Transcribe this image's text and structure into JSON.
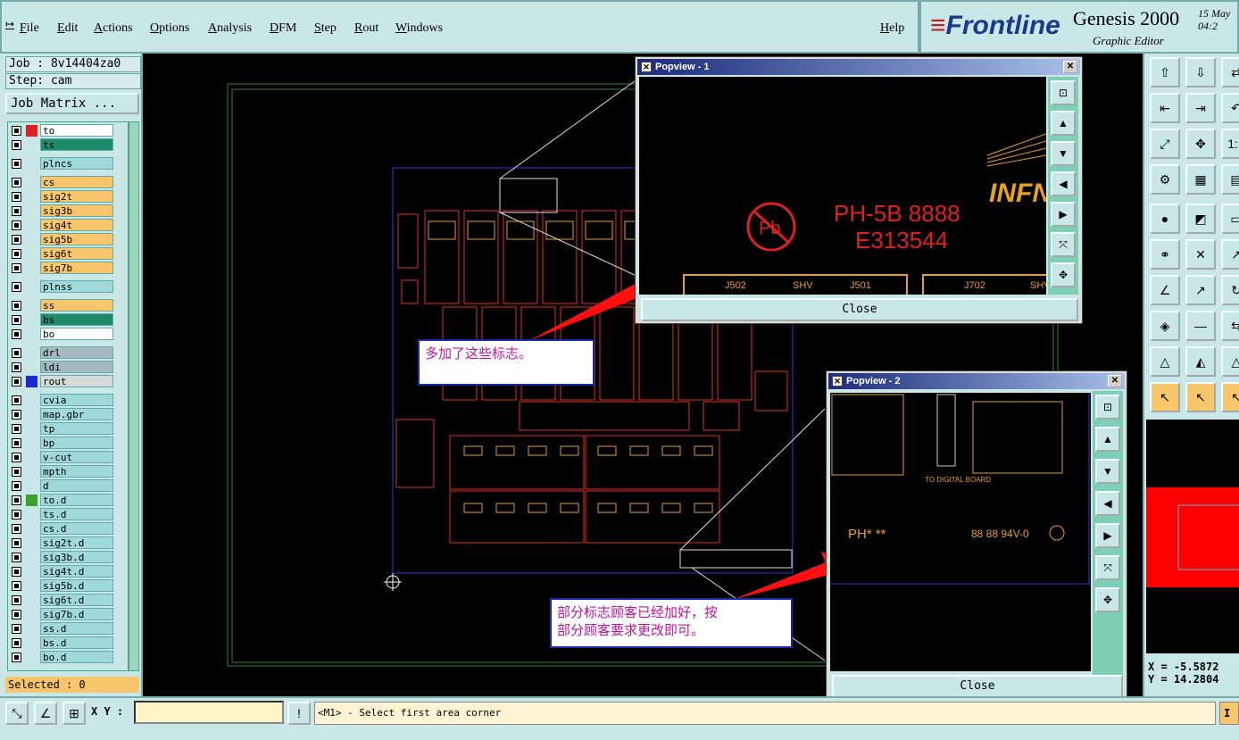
{
  "menu": {
    "items": [
      "File",
      "Edit",
      "Actions",
      "Options",
      "Analysis",
      "DFM",
      "Step",
      "Rout",
      "Windows"
    ],
    "help": "Help"
  },
  "brand": {
    "logo": "Frontline",
    "product": "Genesis 2000",
    "subtitle": "Graphic Editor",
    "date_line1": "15 May",
    "date_line2": "04:2"
  },
  "left": {
    "job": "Job : 8v14404za0",
    "step": "Step: cam",
    "job_matrix": "Job Matrix ...",
    "selected": "Selected : 0"
  },
  "layers": [
    {
      "name": "to",
      "color": "#ffffff",
      "swatch": "#e02020"
    },
    {
      "name": "ts",
      "color": "#1d8a6a"
    },
    {
      "name": "plncs",
      "color": "#9fd9d9"
    },
    {
      "name": "cs",
      "color": "#f7c66a"
    },
    {
      "name": "sig2t",
      "color": "#f7c66a"
    },
    {
      "name": "sig3b",
      "color": "#f7c66a"
    },
    {
      "name": "sig4t",
      "color": "#f7c66a"
    },
    {
      "name": "sig5b",
      "color": "#f7c66a"
    },
    {
      "name": "sig6t",
      "color": "#f7c66a"
    },
    {
      "name": "sig7b",
      "color": "#f7c66a"
    },
    {
      "name": "plnss",
      "color": "#9fd9d9"
    },
    {
      "name": "ss",
      "color": "#f7c66a"
    },
    {
      "name": "bs",
      "color": "#1d8a6a"
    },
    {
      "name": "bo",
      "color": "#ffffff"
    },
    {
      "name": "drl",
      "color": "#a7b9c0"
    },
    {
      "name": "ldi",
      "color": "#a7b9c0"
    },
    {
      "name": "rout",
      "color": "#d8d8d8",
      "swatch": "#1a2ad8"
    },
    {
      "name": "cvia",
      "color": "#9fd9d9"
    },
    {
      "name": "map.gbr",
      "color": "#9fd9d9"
    },
    {
      "name": "tp",
      "color": "#9fd9d9"
    },
    {
      "name": "bp",
      "color": "#9fd9d9"
    },
    {
      "name": "v-cut",
      "color": "#9fd9d9"
    },
    {
      "name": "mpth",
      "color": "#9fd9d9"
    },
    {
      "name": "d",
      "color": "#9fd9d9"
    },
    {
      "name": "to.d",
      "color": "#9fd9d9",
      "swatch": "#3aa02a"
    },
    {
      "name": "ts.d",
      "color": "#9fd9d9"
    },
    {
      "name": "cs.d",
      "color": "#9fd9d9"
    },
    {
      "name": "sig2t.d",
      "color": "#9fd9d9"
    },
    {
      "name": "sig3b.d",
      "color": "#9fd9d9"
    },
    {
      "name": "sig4t.d",
      "color": "#9fd9d9"
    },
    {
      "name": "sig5b.d",
      "color": "#9fd9d9"
    },
    {
      "name": "sig6t.d",
      "color": "#9fd9d9"
    },
    {
      "name": "sig7b.d",
      "color": "#9fd9d9"
    },
    {
      "name": "ss.d",
      "color": "#9fd9d9"
    },
    {
      "name": "bs.d",
      "color": "#9fd9d9"
    },
    {
      "name": "bo.d",
      "color": "#9fd9d9"
    }
  ],
  "popview1": {
    "title": "Popview - 1",
    "close": "Close",
    "marking1": "PH-5B 8888",
    "marking2": "E313544",
    "pb_label": "Pb",
    "logo": "INFN",
    "labels": [
      "J502",
      "SHV",
      "J501",
      "J702",
      "SHV"
    ]
  },
  "popview2": {
    "title": "Popview - 2",
    "close": "Close",
    "marking": "PH* **",
    "code": "88 88 94V-0",
    "board_label": "TO DIGITAL BOARD"
  },
  "notes": {
    "note1": "多加了这些标志。",
    "note2_line1": "部分标志顾客已经加好，按",
    "note2_line2": "部分顾客要求更改即可。"
  },
  "bottom": {
    "xy_label": "X Y :",
    "xy_value": "",
    "status": "<M1> - Select first area corner",
    "status_right": "I"
  },
  "right": {
    "x_coord": "X = -5.5872",
    "y_coord": "Y = 14.2804"
  },
  "colors": {
    "panel": "#c9e7e7",
    "canvas": "#000000",
    "pcb_red": "#e03020",
    "arrow": "#ff1010"
  }
}
